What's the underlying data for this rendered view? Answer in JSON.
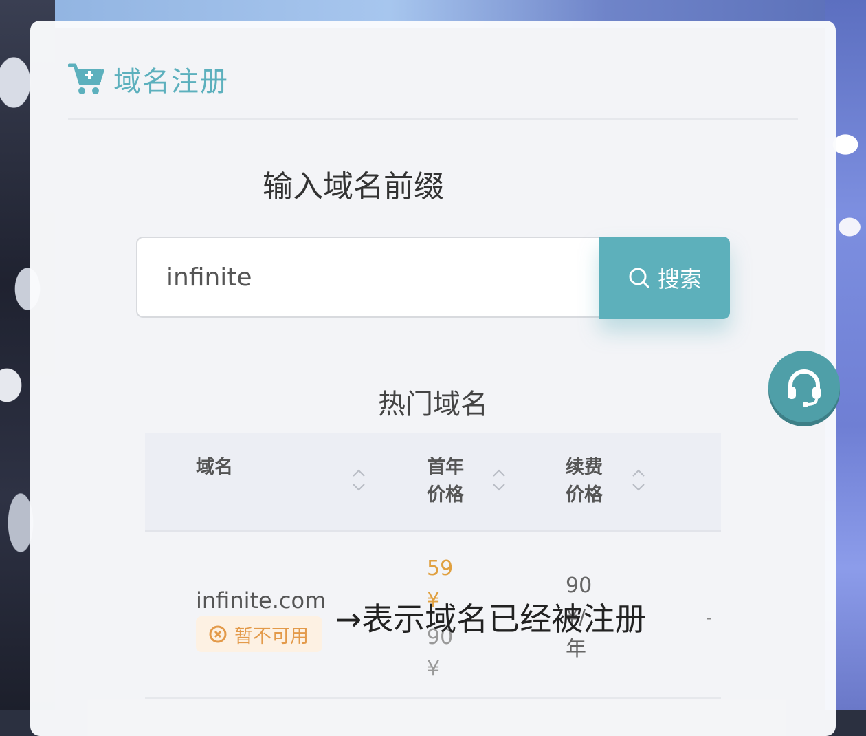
{
  "header": {
    "title": "域名注册",
    "icon": "cart-plus-icon"
  },
  "search": {
    "title": "输入域名前缀",
    "value": "infinite",
    "button_label": "搜索",
    "accent": "#5db0bb"
  },
  "hot": {
    "title": "热门域名",
    "columns": [
      "域名",
      "首年\n价格",
      "续费\n价格"
    ],
    "rows": [
      {
        "domain": "infinite.com",
        "status": "暂不可用",
        "first_year_price": "59\n¥",
        "first_year_original": "90\n¥",
        "renewal_price": "90\n¥/\n年",
        "action": "-"
      }
    ]
  },
  "annotation": "→表示域名已经被注册",
  "support": {
    "icon": "headset-icon"
  }
}
